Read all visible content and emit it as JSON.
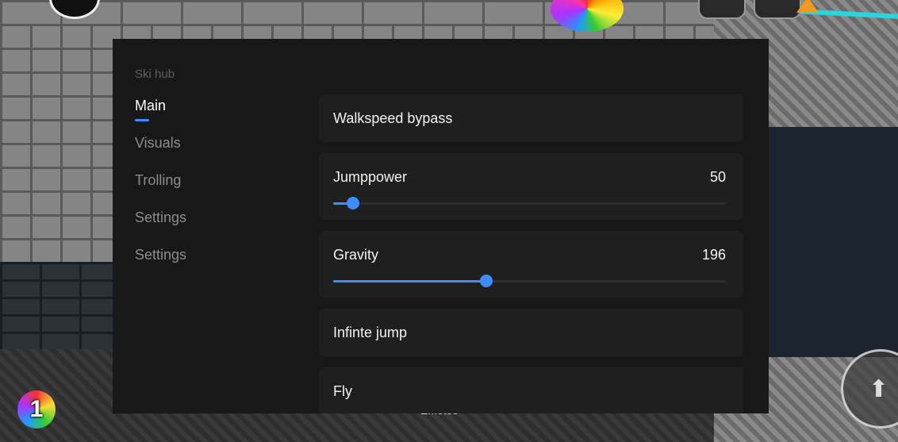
{
  "hub": {
    "title": "Ski hub",
    "nav": [
      {
        "label": "Main",
        "active": true
      },
      {
        "label": "Visuals",
        "active": false
      },
      {
        "label": "Trolling",
        "active": false
      },
      {
        "label": "Settings",
        "active": false
      },
      {
        "label": "Settings",
        "active": false
      }
    ],
    "toggles": {
      "walkspeed": "Walkspeed bypass",
      "infinite_jump": "Infinte jump",
      "fly": "Fly"
    },
    "sliders": {
      "jumppower": {
        "label": "Jumppower",
        "value": "50",
        "fill_fraction": 0.05
      },
      "gravity": {
        "label": "Gravity",
        "value": "196",
        "fill_fraction": 0.39
      }
    }
  },
  "game": {
    "badge_number": "1",
    "emotes_label": "Emotes"
  },
  "colors": {
    "accent": "#3f8cff",
    "panel": "#181818",
    "card": "#1f1f1f"
  }
}
